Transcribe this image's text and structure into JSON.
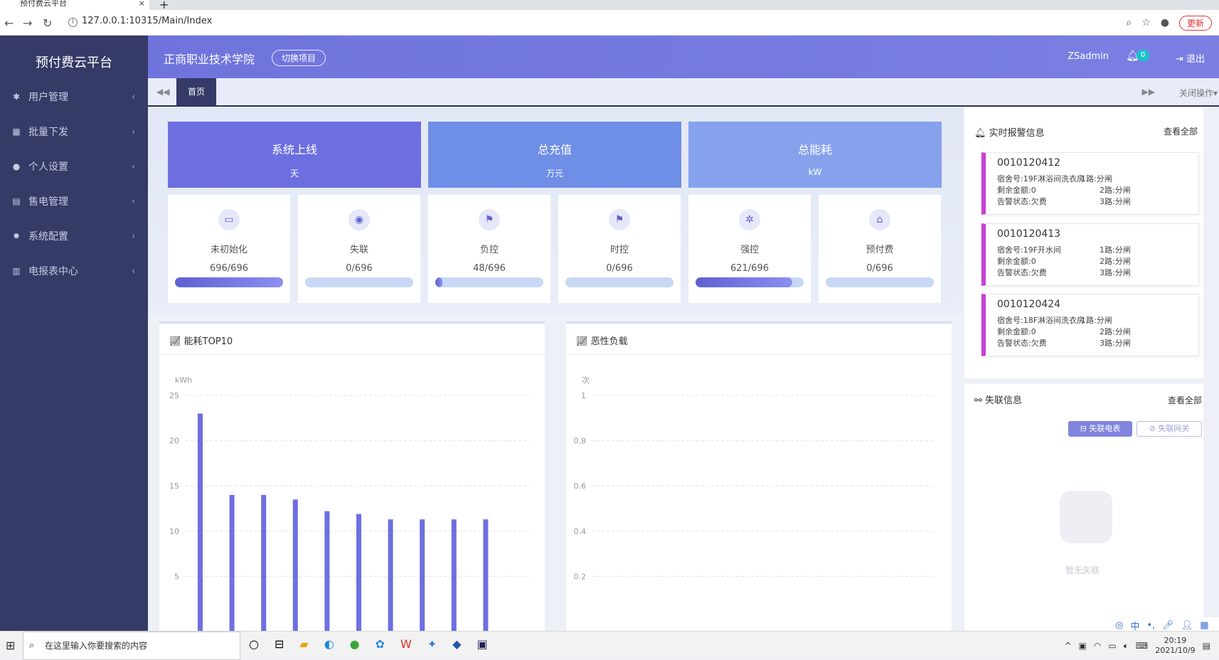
{
  "browser": {
    "tab_title": "预付费云平台",
    "tab_close": "×",
    "new_tab": "+",
    "url": "127.0.0.1:10315/Main/Index",
    "update_label": "更新"
  },
  "sidebar": {
    "brand": "预付费云平台",
    "items": [
      {
        "icon": "✱",
        "label": "用户管理"
      },
      {
        "icon": "▦",
        "label": "批量下发"
      },
      {
        "icon": "●",
        "label": "个人设置"
      },
      {
        "icon": "▤",
        "label": "售电管理"
      },
      {
        "icon": "✹",
        "label": "系统配置"
      },
      {
        "icon": "▥",
        "label": "电报表中心"
      }
    ],
    "chevron": "‹"
  },
  "header": {
    "school": "正商职业技术学院",
    "switch_label": "切换项目",
    "user": "ZSadmin",
    "notif_count": "0",
    "logout": "退出"
  },
  "tabnav": {
    "home": "首页",
    "close_ops": "关闭操作"
  },
  "stats": [
    {
      "title": "系统上线",
      "unit": "天",
      "color": "#6d6fe0"
    },
    {
      "title": "总充值",
      "unit": "万元",
      "color": "#6f8ee6"
    },
    {
      "title": "总能耗",
      "unit": "kW",
      "color": "#86a2ec"
    }
  ],
  "status_cards": [
    {
      "icon": "▭",
      "label": "未初始化",
      "value": "696/696",
      "fraction": 1.0
    },
    {
      "icon": "◉",
      "label": "失联",
      "value": "0/696",
      "fraction": 0.0
    },
    {
      "icon": "⚑",
      "label": "负控",
      "value": "48/696",
      "fraction": 0.069
    },
    {
      "icon": "⚑",
      "label": "时控",
      "value": "0/696",
      "fraction": 0.0
    },
    {
      "icon": "✲",
      "label": "强控",
      "value": "621/696",
      "fraction": 0.892
    },
    {
      "icon": "⌂",
      "label": "预付费",
      "value": "0/696",
      "fraction": 0.0
    }
  ],
  "energy_panel": {
    "title": "能耗TOP10"
  },
  "load_panel": {
    "title": "恶性负载"
  },
  "chart_data": [
    {
      "type": "bar",
      "title": "",
      "ylabel": "kWh",
      "ylim": [
        0,
        25
      ],
      "yticks": [
        "25",
        "20",
        "15",
        "10",
        "5"
      ],
      "values": [
        23,
        14,
        14,
        13.5,
        12.2,
        11.9,
        11.3,
        11.3,
        11.3,
        11.3
      ],
      "color": "#6d6fe0"
    },
    {
      "type": "bar",
      "title": "",
      "ylabel": "次",
      "ylim": [
        0,
        1
      ],
      "yticks": [
        "1",
        "0.8",
        "0.6",
        "0.4",
        "0.2"
      ],
      "values": []
    }
  ],
  "alarms": {
    "title": "实时报警信息",
    "view_all": "查看全部",
    "items": [
      {
        "meter": "0010120412",
        "room": "宿舍号:19F淋浴间洗衣房",
        "balance": "剩余金额:0",
        "status": "告警状态:欠费",
        "r1": "1路:分闸",
        "r2": "2路:分闸",
        "r3": "3路:分闸"
      },
      {
        "meter": "0010120413",
        "room": "宿舍号:19F开水间",
        "balance": "剩余金额:0",
        "status": "告警状态:欠费",
        "r1": "1路:分闸",
        "r2": "2路:分闸",
        "r3": "3路:分闸"
      },
      {
        "meter": "0010120424",
        "room": "宿舍号:18F淋浴间洗衣房",
        "balance": "剩余金额:0",
        "status": "告警状态:欠费",
        "r1": "1路:分闸",
        "r2": "2路:分闸",
        "r3": "3路:分闸"
      }
    ]
  },
  "lost": {
    "title": "失联信息",
    "view_all": "查看全部",
    "btn_meter": "⊟ 失联电表",
    "btn_gateway": "⊘ 失联网关",
    "empty": "暂无失联"
  },
  "taskbar": {
    "search_placeholder": "在这里输入你要搜索的内容",
    "time": "20:19",
    "date": "2021/10/9",
    "ime": "中"
  }
}
